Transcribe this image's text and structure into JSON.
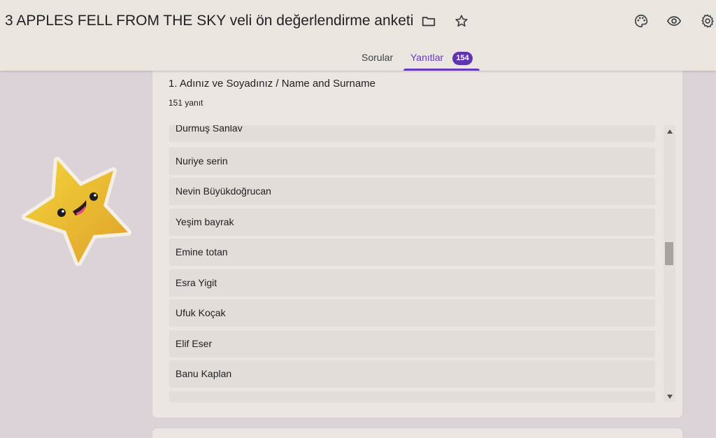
{
  "header": {
    "title": "3 APPLES FELL FROM THE SKY veli ön değerlendirme anketi",
    "icons": [
      "folder-icon",
      "star-icon",
      "palette-icon",
      "eye-icon",
      "gear-icon"
    ]
  },
  "tabs": [
    {
      "label": "Sorular"
    },
    {
      "label": "Yanıtlar",
      "badge": "154"
    }
  ],
  "question": {
    "title": "1. Adınız ve Soyadınız / Name and Surname",
    "count": "151 yanıt",
    "responses": [
      "Durmuş Sanlav",
      "Nuriye serin",
      "Nevin Büyükdoğrucan",
      "Yeşim bayrak",
      "Emine totan",
      "Esra Yigit",
      "Ufuk Koçak",
      "Elif Eser",
      "Banu Kaplan"
    ]
  },
  "colors": {
    "accent": "#673ab7",
    "badge": "#5e35b1",
    "background": "#dcd3d8",
    "header": "#ebe5df"
  }
}
